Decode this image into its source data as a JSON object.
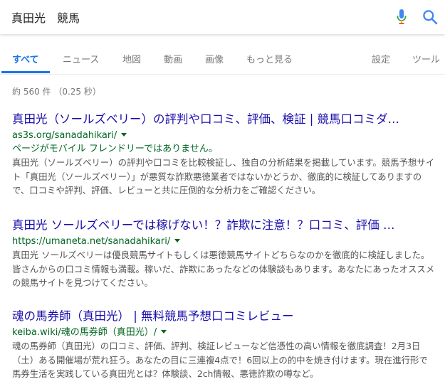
{
  "search": {
    "query": "真田光　競馬"
  },
  "icons": {
    "mic": "mic-icon",
    "search": "search-icon"
  },
  "tabs": [
    {
      "label": "すべて",
      "active": true
    },
    {
      "label": "ニュース"
    },
    {
      "label": "地図"
    },
    {
      "label": "動画"
    },
    {
      "label": "画像"
    },
    {
      "label": "もっと見る"
    },
    {
      "label": "設定"
    },
    {
      "label": "ツール"
    }
  ],
  "stats": "約 560 件 （0.25 秒）",
  "results": [
    {
      "title": "真田光（ソールズベリー）の評判や口コミ、評価、検証 | 競馬口コミダ…",
      "url": "as3s.org/sanadahikari/",
      "note": "ページがモバイル フレンドリーではありません。",
      "snippet": "真田光（ソールズベリー）の評判や口コミを比較検証し、独自の分析結果を掲載しています。競馬予想サイト「真田光（ソールズベリー）」が悪質な詐欺悪徳業者ではないかどうか、徹底的に検証してありますので、口コミや評判、評価、レビューと共に圧倒的な分析力をご確認ください。"
    },
    {
      "title": "真田光 ソールズベリーでは稼げない！？詐欺に注意！？口コミ、評価 …",
      "url": "https://umaneta.net/sanadahikari/",
      "snippet": "真田光 ソールズベリーは優良競馬サイトもしくは悪徳競馬サイトどちらなのかを徹底的に検証しました。皆さんからの口コミ情報も満載。稼いだ、詐欺にあったなどの体験談もあります。あなたにあったオススメの競馬サイトを見つけてください。"
    },
    {
      "title": "魂の馬券師（真田光） | 無料競馬予想口コミレビュー",
      "url": "keiba.wiki/魂の馬券師（真田光）/",
      "snippet": "魂の馬券師（真田光）の口コミ、評価、評判、検証レビューなど信憑性の高い情報を徹底調査！2月3日（土）ある開催場が荒れ狂う。あなたの目に三連複4点で！6回以上の的中を焼き付けます。現在進行形で馬券生活を実践している真田光とは？体験談、2ch情報、悪徳詐欺の噂など。"
    }
  ],
  "colors": {
    "link": "#1a0dab",
    "url": "#006621",
    "active_tab": "#1a73e8",
    "snippet": "#545454",
    "muted": "#777777"
  }
}
